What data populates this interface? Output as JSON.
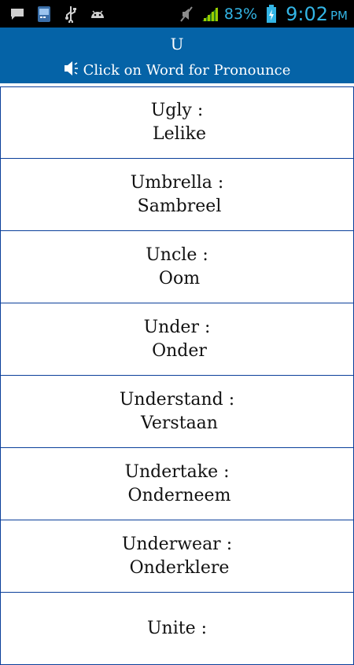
{
  "status_bar": {
    "battery_percent": "83%",
    "time": "9:02",
    "ampm": "PM",
    "icons": [
      "message-icon",
      "keyboard-icon",
      "usb-icon",
      "android-icon",
      "mute-icon",
      "signal-icon",
      "battery-charging-icon"
    ]
  },
  "header": {
    "title": "U",
    "subtitle": "Click on Word for Pronounce",
    "speaker_icon": "speaker-icon",
    "background": "#0563a7"
  },
  "words": [
    {
      "word": "Ugly :",
      "translation": "Lelike"
    },
    {
      "word": "Umbrella :",
      "translation": "Sambreel"
    },
    {
      "word": "Uncle :",
      "translation": "Oom"
    },
    {
      "word": "Under :",
      "translation": "Onder"
    },
    {
      "word": "Understand :",
      "translation": "Verstaan"
    },
    {
      "word": "Undertake :",
      "translation": "Onderneem"
    },
    {
      "word": "Underwear :",
      "translation": "Onderklere"
    },
    {
      "word": "Unite :",
      "translation": ""
    }
  ]
}
